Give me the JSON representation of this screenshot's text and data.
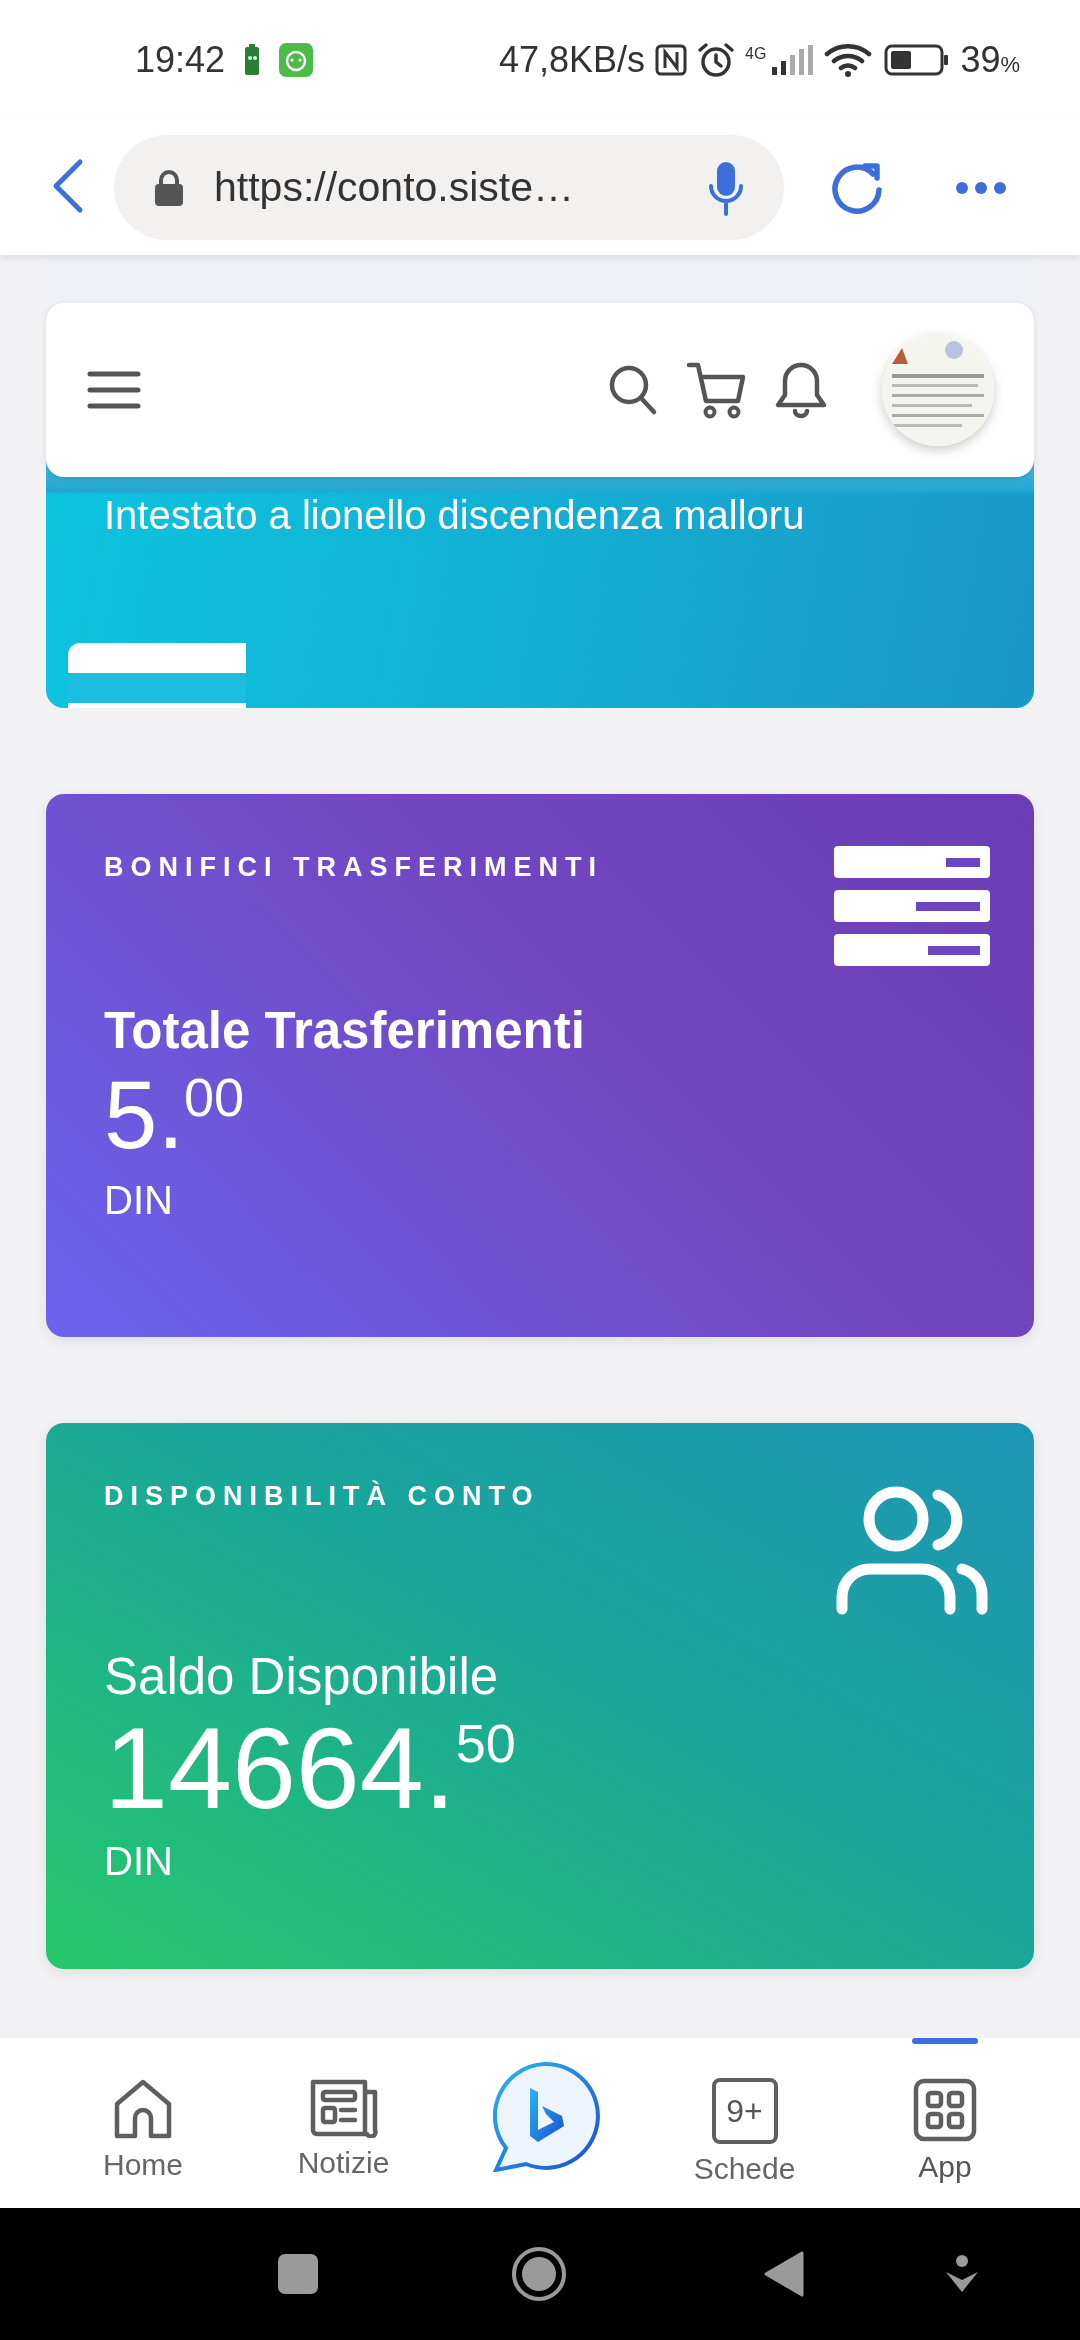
{
  "status_bar": {
    "time": "19:42",
    "net_speed": "47,8KB/s",
    "network": "4G",
    "battery": "39",
    "battery_unit": "%"
  },
  "browser": {
    "url": "https://conto.siste…"
  },
  "account_card": {
    "owner": "Intestato a lionello discendenza malloru"
  },
  "cards": [
    {
      "kind": "transfers",
      "label": "BONIFICI TRASFERIMENTI",
      "title": "Totale Trasferimenti",
      "amount": "5.",
      "cents": "00",
      "currency": "DIN"
    },
    {
      "kind": "balance",
      "label": "DISPONIBILITÀ CONTO",
      "title": "Saldo Disponibile",
      "amount": "14664.",
      "cents": "50",
      "currency": "DIN"
    }
  ],
  "bottom_nav": [
    {
      "kind": "home",
      "label": "Home",
      "selected": false
    },
    {
      "kind": "news",
      "label": "Notizie",
      "selected": false
    },
    {
      "kind": "assistant",
      "selected": false
    },
    {
      "kind": "tabs",
      "label": "Schede",
      "badge": "9+",
      "selected": false
    },
    {
      "kind": "apps",
      "label": "App",
      "selected": true
    }
  ]
}
